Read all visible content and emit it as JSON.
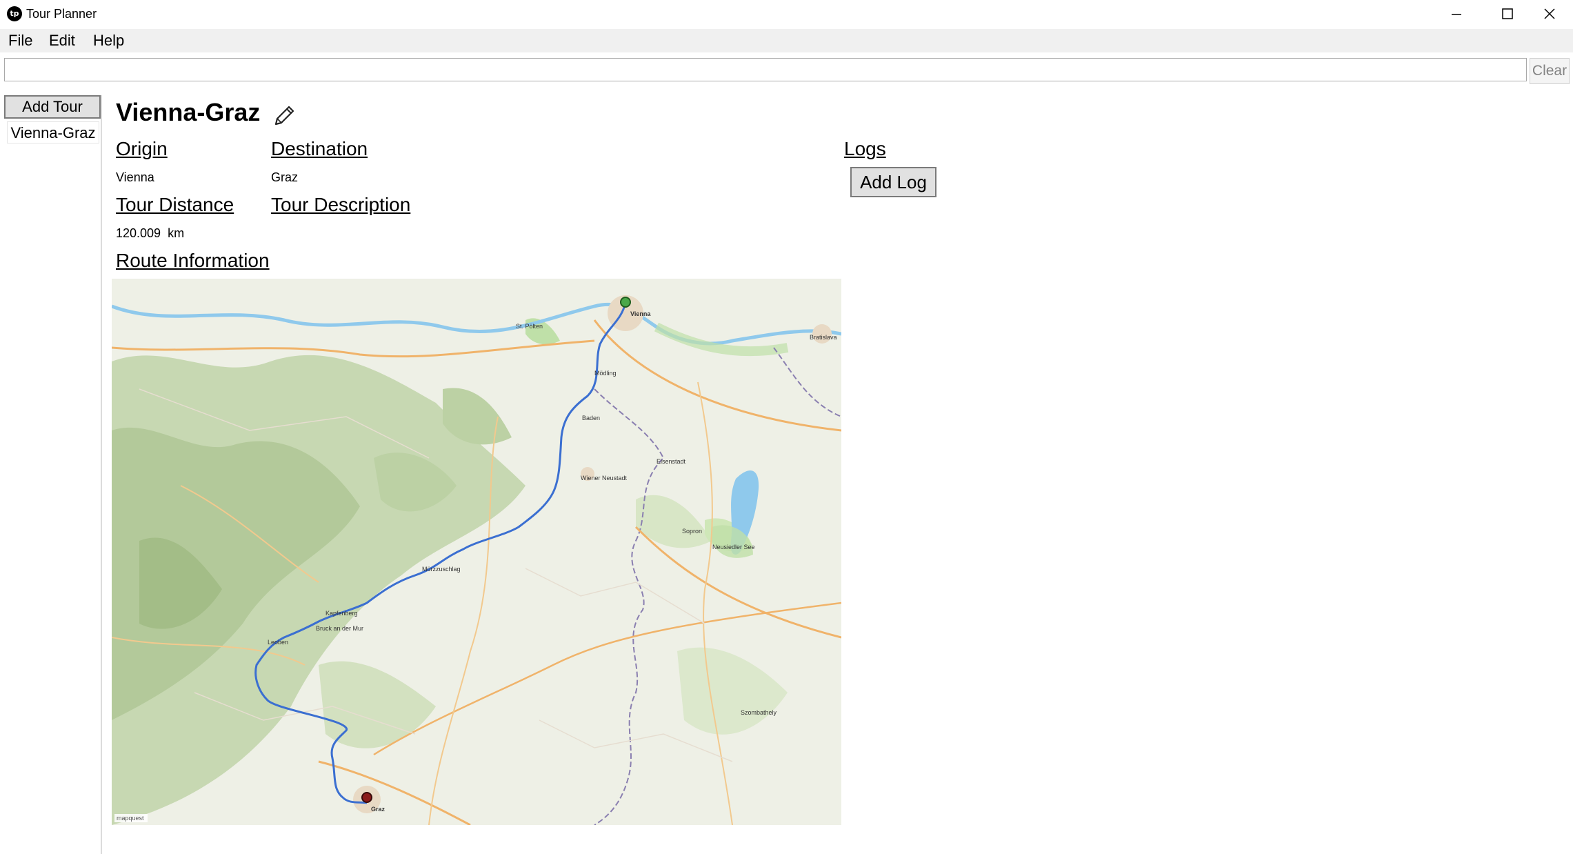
{
  "window": {
    "app_icon": "tour-planner-logo-icon",
    "title": "Tour Planner",
    "controls": [
      "minimize-icon",
      "maximize-icon",
      "close-icon"
    ]
  },
  "menu": {
    "items": [
      "File",
      "Edit",
      "Help"
    ]
  },
  "search": {
    "value": "",
    "clear_label": "Clear"
  },
  "sidebar": {
    "add_tour_label": "Add Tour",
    "tours": [
      "Vienna-Graz"
    ]
  },
  "tour": {
    "title": "Vienna-Graz",
    "edit_icon": "pencil-icon",
    "origin_label": "Origin",
    "origin": "Vienna",
    "destination_label": "Destination",
    "destination": "Graz",
    "distance_label": "Tour Distance",
    "distance_value": "120.009",
    "distance_unit": "km",
    "description_label": "Tour Description",
    "description": "",
    "route_label": "Route Information"
  },
  "logs": {
    "label": "Logs",
    "add_log_label": "Add Log"
  },
  "map": {
    "attribution": "mapquest",
    "route_color": "#3b6fd1",
    "start_marker_color": "#4aa84a",
    "end_marker_color": "#8b1a1a",
    "water_color": "#8fc9ec",
    "land_color": "#eef0e6",
    "forest_color": "#c7d8b2",
    "labels": [
      "Vienna",
      "Graz",
      "Bratislava",
      "Wiener Neustadt",
      "Eisenstadt",
      "Sopron",
      "Neusiedler See",
      "Mürzzuschlag",
      "Bruck an der Mur",
      "Kapfenberg",
      "Leoben",
      "St. Pölten",
      "Mödling",
      "Baden",
      "Szombathely"
    ]
  }
}
